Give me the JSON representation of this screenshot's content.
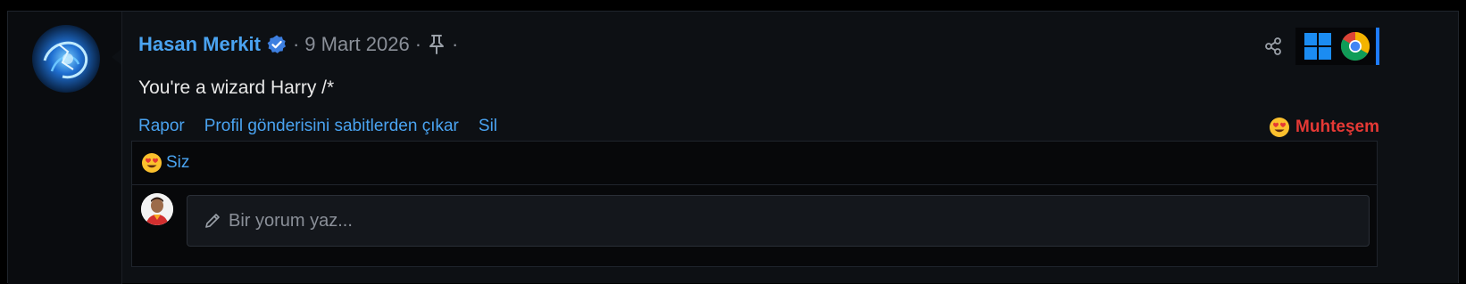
{
  "post": {
    "author": "Hasan Merkit",
    "separator": "·",
    "date": "9 Mart 2026",
    "content": "You're a wizard Harry /*",
    "actions": {
      "report": "Rapor",
      "unpin": "Profil gönderisini sabitlerden çıkar",
      "delete": "Sil"
    },
    "reaction_label": "Muhteşem",
    "reactors": "Siz",
    "comment_placeholder": "Bir yorum yaz..."
  },
  "icons": {
    "verified": "verified-badge-icon",
    "pin": "pin-icon",
    "share": "share-icon",
    "windows": "windows-icon",
    "chrome": "chrome-icon",
    "reaction_emoji": "heart-eyes-emoji-icon",
    "pencil": "pencil-icon"
  },
  "colors": {
    "link": "#4aa3f0",
    "reaction": "#e53935",
    "background": "#0d1014"
  }
}
